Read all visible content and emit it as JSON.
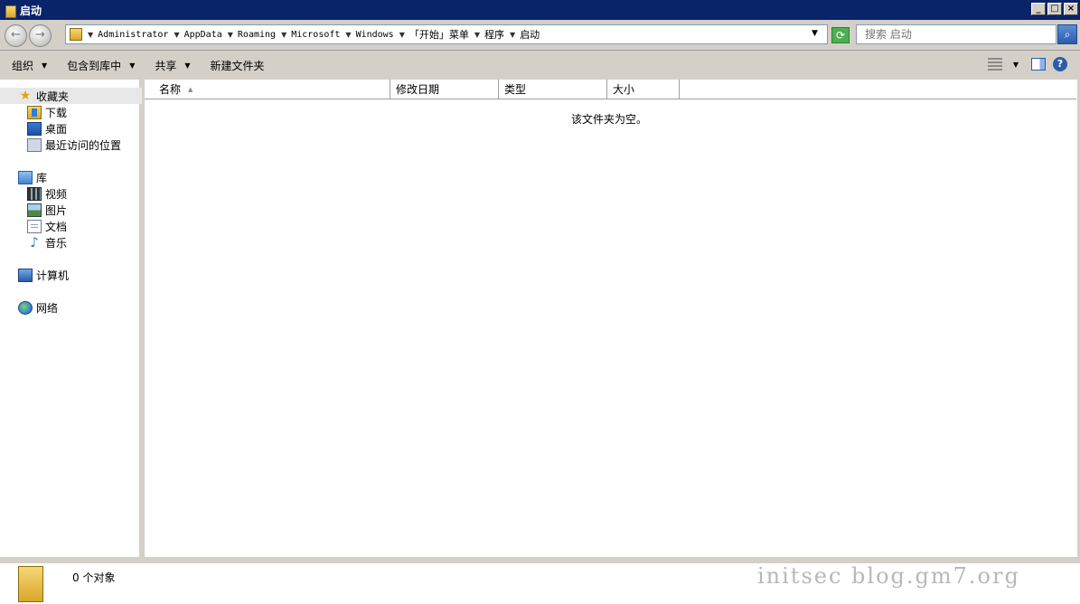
{
  "window": {
    "title": "启动"
  },
  "address": {
    "crumbs": [
      {
        "label": "Administrator",
        "mono": true
      },
      {
        "label": "AppData",
        "mono": true
      },
      {
        "label": "Roaming",
        "mono": true
      },
      {
        "label": "Microsoft",
        "mono": true
      },
      {
        "label": "Windows",
        "mono": true
      },
      {
        "label": "「开始」菜单",
        "mono": false
      },
      {
        "label": "程序",
        "mono": false
      },
      {
        "label": "启动",
        "mono": false
      }
    ]
  },
  "search": {
    "placeholder": "搜索 启动"
  },
  "toolbar": {
    "organize": "组织",
    "include_library": "包含到库中",
    "share": "共享",
    "new_folder": "新建文件夹"
  },
  "nav": {
    "favorites": "收藏夹",
    "downloads": "下载",
    "desktop": "桌面",
    "recent": "最近访问的位置",
    "libraries": "库",
    "videos": "视频",
    "pictures": "图片",
    "documents": "文档",
    "music": "音乐",
    "computer": "计算机",
    "network": "网络"
  },
  "columns": {
    "name": "名称",
    "modified": "修改日期",
    "type": "类型",
    "size": "大小"
  },
  "content": {
    "empty_message": "该文件夹为空。"
  },
  "status": {
    "count": "0 个对象",
    "watermark": "initsec blog.gm7.org"
  }
}
